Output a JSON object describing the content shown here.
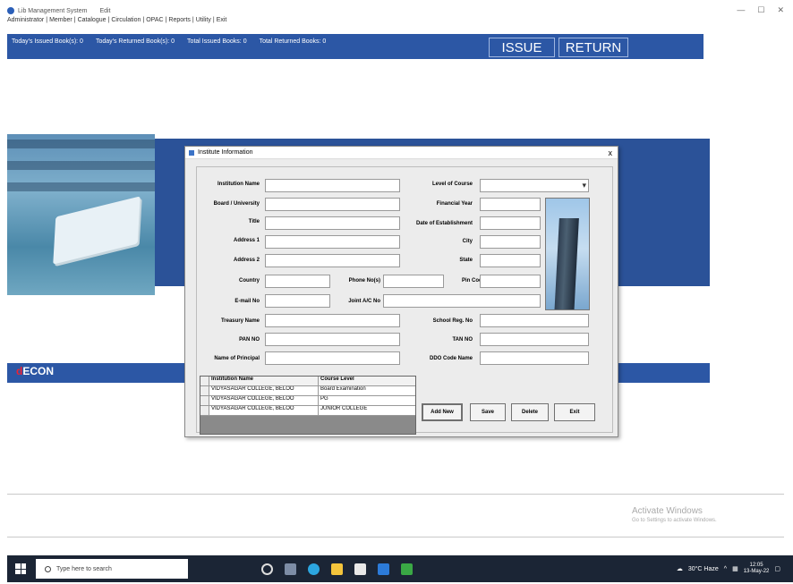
{
  "window": {
    "title": "Lib Management System",
    "title_suffix": "Edit",
    "controls": [
      "—",
      "☐",
      "✕"
    ]
  },
  "menu": {
    "items": [
      "Administrator",
      "Member",
      "Catalogue",
      "Circulation",
      "OPAC",
      "Reports",
      "Utility",
      "Exit"
    ]
  },
  "status": {
    "issued_today": "Today's Issued Book(s): 0",
    "returned_today": "Today's Returned Book(s): 0",
    "total_issued": "Total Issued Books: 0",
    "total_returned": "Total Returned Books: 0",
    "issue_label": "ISSUE",
    "return_label": "RETURN"
  },
  "branding": {
    "logo_prefix": "d",
    "logo_text": "ECON"
  },
  "dialog": {
    "title": "Institute Information",
    "close": "x",
    "labels": {
      "institution_name": "Institution Name",
      "board_university": "Board / University",
      "title": "Title",
      "address1": "Address 1",
      "address2": "Address 2",
      "country": "Country",
      "phone": "Phone No(s)",
      "pin_code": "Pin Code",
      "email": "E-mail No",
      "joint_ac": "Joint A/C No",
      "treasury_name": "Treasury Name",
      "pan": "PAN NO",
      "principal": "Name of Principal",
      "level_of_course": "Level of Course",
      "financial_year": "Financial Year",
      "date_established": "Date of Establishment",
      "city": "City",
      "state": "State",
      "school_reg": "School Reg. No",
      "tan": "TAN NO",
      "ddo_code": "DDO Code Name"
    },
    "grid": {
      "headers": [
        "Institution Name",
        "Course Level"
      ],
      "rows": [
        [
          "VIDYASAGAR COLLEGE, BELOO",
          "Board Examination"
        ],
        [
          "VIDYASAGAR COLLEGE, BELOO",
          "PG"
        ],
        [
          "VIDYASAGAR COLLEGE, BELOO",
          "JUNIOR COLLEGE"
        ]
      ]
    },
    "buttons": {
      "add_new": "Add New",
      "save": "Save",
      "delete": "Delete",
      "exit": "Exit"
    }
  },
  "watermark": {
    "line1": "Activate Windows",
    "line2": "Go to Settings to activate Windows."
  },
  "taskbar": {
    "search_placeholder": "Type here to search",
    "weather": "30°C Haze",
    "time": "12:05",
    "date": "13-May-22"
  }
}
